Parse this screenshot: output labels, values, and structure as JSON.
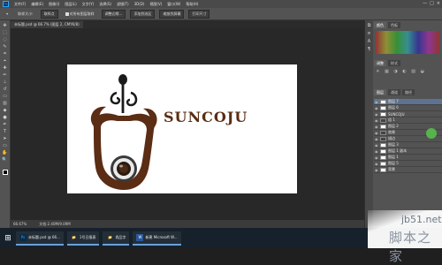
{
  "colors": {
    "brand": "#5a2d14",
    "menubar": "#4a4a4a",
    "panel": "#535353",
    "selection": "#5e7391"
  },
  "menubar": {
    "logo": "Ps",
    "items": [
      "文件(F)",
      "编辑(E)",
      "图像(I)",
      "图层(L)",
      "文字(Y)",
      "选择(S)",
      "滤镜(T)",
      "3D(D)",
      "视图(V)",
      "窗口(W)",
      "帮助(H)"
    ],
    "window_controls": [
      "—",
      "□",
      "×"
    ]
  },
  "options": {
    "sample_size": "取样大小:",
    "sample_value": "取样点",
    "all_layers": "对所有图层取样",
    "buttons": [
      "调整边缘...",
      "添加到选区",
      "缩放到屏幕",
      "打印尺寸"
    ]
  },
  "document_tab": {
    "title": "未标题.psd @ 66.7% (图层 2, CMYK/8)"
  },
  "logo": {
    "brand_text": "SUNCOJU"
  },
  "status": {
    "zoom": "66.67%",
    "doc_size": "文档:2.40M/9.09M"
  },
  "panels": {
    "top_tabs": [
      "颜色",
      "色板"
    ],
    "mid_tabs": [
      "调整",
      "样式"
    ],
    "layer_tabs": [
      "图层",
      "通道",
      "路径"
    ],
    "layers": [
      {
        "name": "图层 7",
        "selected": true
      },
      {
        "name": "图层 6",
        "selected": false
      },
      {
        "name": "SUNCOJU",
        "selected": false
      },
      {
        "name": "组 1",
        "selected": false
      },
      {
        "name": "图层 2",
        "selected": false
      },
      {
        "name": "效果",
        "selected": false
      },
      {
        "name": "描边",
        "selected": false
      },
      {
        "name": "图层 3",
        "selected": false
      },
      {
        "name": "图层 1 副本",
        "selected": false
      },
      {
        "name": "图层 1",
        "selected": false
      },
      {
        "name": "图层 5",
        "selected": false
      },
      {
        "name": "背景",
        "selected": false
      }
    ]
  },
  "taskbar": {
    "tasks": [
      {
        "icon": "Ps",
        "label": "未标题.psd @ 66..."
      },
      {
        "icon": "📁",
        "label": "1号日报表"
      },
      {
        "icon": "📁",
        "label": "尚品字"
      },
      {
        "icon": "W",
        "label": "新建 Microsoft W..."
      }
    ]
  },
  "watermark": {
    "domain": "jb51.net",
    "text": "脚本之家"
  }
}
